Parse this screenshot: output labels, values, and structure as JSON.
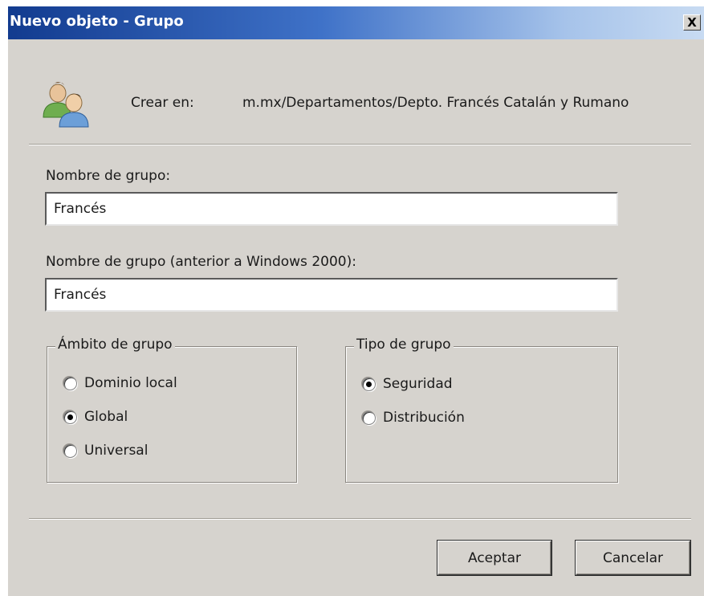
{
  "window": {
    "title": "Nuevo objeto - Grupo",
    "close_glyph": "X"
  },
  "header": {
    "icon": "group-users-icon",
    "create_in_label": "Crear en:",
    "create_in_path": "m.mx/Departamentos/Depto. Francés Catalán y Rumano"
  },
  "group_name": {
    "label": "Nombre de grupo:",
    "value": "Francés"
  },
  "group_name_pre2000": {
    "label": "Nombre de grupo (anterior a Windows 2000):",
    "value": "Francés"
  },
  "scope": {
    "legend": "Ámbito de grupo",
    "options": [
      {
        "label": "Dominio local",
        "checked": false
      },
      {
        "label": "Global",
        "checked": true
      },
      {
        "label": "Universal",
        "checked": false
      }
    ]
  },
  "type": {
    "legend": "Tipo de grupo",
    "options": [
      {
        "label": "Seguridad",
        "checked": true
      },
      {
        "label": "Distribución",
        "checked": false
      }
    ]
  },
  "buttons": {
    "ok": "Aceptar",
    "cancel": "Cancelar"
  }
}
